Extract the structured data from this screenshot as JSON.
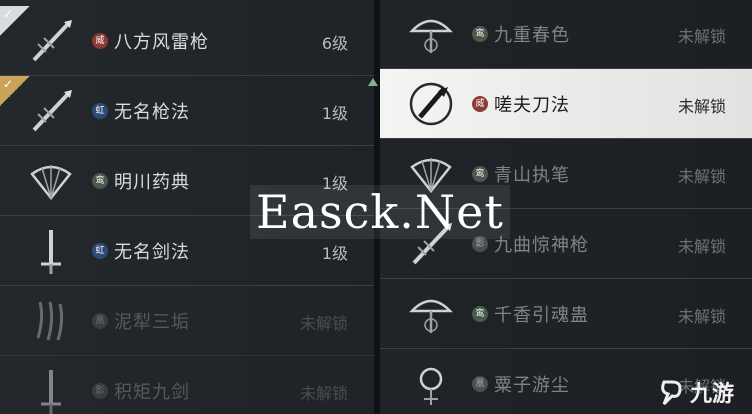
{
  "left_list": [
    {
      "name": "八方风雷枪",
      "level": "6级",
      "badge": "威",
      "badge_color": "red",
      "icon": "spear-icon",
      "check": "white",
      "locked": false
    },
    {
      "name": "无名枪法",
      "level": "1级",
      "badge": "虹",
      "badge_color": "blue",
      "icon": "spear-icon",
      "check": "gold",
      "locked": false
    },
    {
      "name": "明川药典",
      "level": "1级",
      "badge": "鸾",
      "badge_color": "green",
      "icon": "fan-icon",
      "check": "",
      "locked": false
    },
    {
      "name": "无名剑法",
      "level": "1级",
      "badge": "虹",
      "badge_color": "blue",
      "icon": "sword-icon",
      "check": "",
      "locked": false
    },
    {
      "name": "泥犁三垢",
      "level": "未解锁",
      "badge": "凰",
      "badge_color": "gray",
      "icon": "claw-icon",
      "check": "",
      "locked": true
    },
    {
      "name": "积矩九剑",
      "level": "未解锁",
      "badge": "影",
      "badge_color": "gray",
      "icon": "sword-icon",
      "check": "",
      "locked": true
    }
  ],
  "right_list": [
    {
      "name": "九重春色",
      "level": "未解锁",
      "badge": "鸾",
      "badge_color": "green",
      "icon": "umbrella-icon",
      "selected": false
    },
    {
      "name": "嗟夫刀法",
      "level": "未解锁",
      "badge": "威",
      "badge_color": "red",
      "icon": "blade-icon",
      "selected": true
    },
    {
      "name": "青山执笔",
      "level": "未解锁",
      "badge": "鸾",
      "badge_color": "green",
      "icon": "fan-icon",
      "selected": false
    },
    {
      "name": "九曲惊神枪",
      "level": "未解锁",
      "badge": "影",
      "badge_color": "gray",
      "icon": "spear-icon",
      "selected": false
    },
    {
      "name": "千香引魂蛊",
      "level": "未解锁",
      "badge": "鸾",
      "badge_color": "green",
      "icon": "umbrella-icon",
      "selected": false
    },
    {
      "name": "粟子游尘",
      "level": "未解锁",
      "badge": "凰",
      "badge_color": "gray",
      "icon": "ring-icon",
      "selected": false
    }
  ],
  "watermark": "Easck.Net",
  "logo_text": "九游"
}
